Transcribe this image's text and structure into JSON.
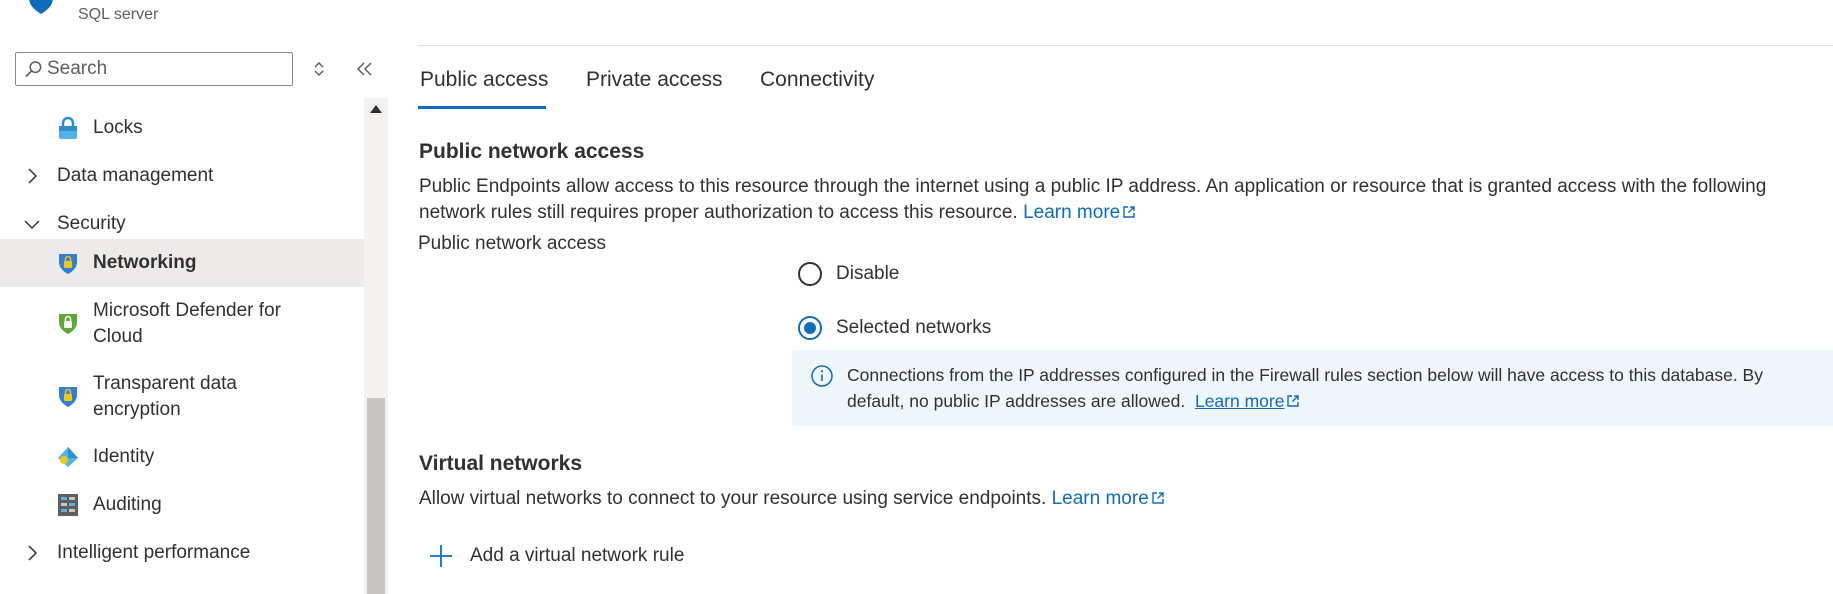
{
  "header": {
    "resource_type": "SQL server"
  },
  "sidebar": {
    "search": {
      "placeholder": "Search",
      "value": ""
    },
    "items": [
      {
        "label": "Locks",
        "kind": "child",
        "icon": "lock-icon"
      },
      {
        "label": "Data management",
        "kind": "group",
        "expanded": false
      },
      {
        "label": "Security",
        "kind": "group",
        "expanded": true
      },
      {
        "label": "Networking",
        "kind": "child",
        "icon": "shield-lock-icon",
        "selected": true
      },
      {
        "label": "Microsoft Defender for Cloud",
        "kind": "child",
        "icon": "defender-shield-icon"
      },
      {
        "label": "Transparent data encryption",
        "kind": "child",
        "icon": "shield-lock-icon"
      },
      {
        "label": "Identity",
        "kind": "child",
        "icon": "identity-icon"
      },
      {
        "label": "Auditing",
        "kind": "child",
        "icon": "auditing-icon"
      },
      {
        "label": "Intelligent performance",
        "kind": "group",
        "expanded": false
      }
    ]
  },
  "tabs": [
    {
      "label": "Public access",
      "active": true
    },
    {
      "label": "Private access",
      "active": false
    },
    {
      "label": "Connectivity",
      "active": false
    }
  ],
  "public_network": {
    "heading": "Public network access",
    "description": "Public Endpoints allow access to this resource through the internet using a public IP address. An application or resource that is granted access with the following network rules still requires proper authorization to access this resource.",
    "learn_more": "Learn more",
    "field_label": "Public network access",
    "options": [
      {
        "label": "Disable",
        "checked": false
      },
      {
        "label": "Selected networks",
        "checked": true
      }
    ],
    "info": {
      "text": "Connections from the IP addresses configured in the Firewall rules section below will have access to this database. By default, no public IP addresses are allowed.",
      "learn_more": "Learn more"
    }
  },
  "virtual_networks": {
    "heading": "Virtual networks",
    "description": "Allow virtual networks to connect to your resource using service endpoints.",
    "learn_more": "Learn more",
    "add_rule_label": "Add a virtual network rule"
  },
  "colors": {
    "accent": "#0f6cbd",
    "selected_bg": "#edebe9",
    "info_bg": "#eff6fc",
    "text": "#323130"
  }
}
